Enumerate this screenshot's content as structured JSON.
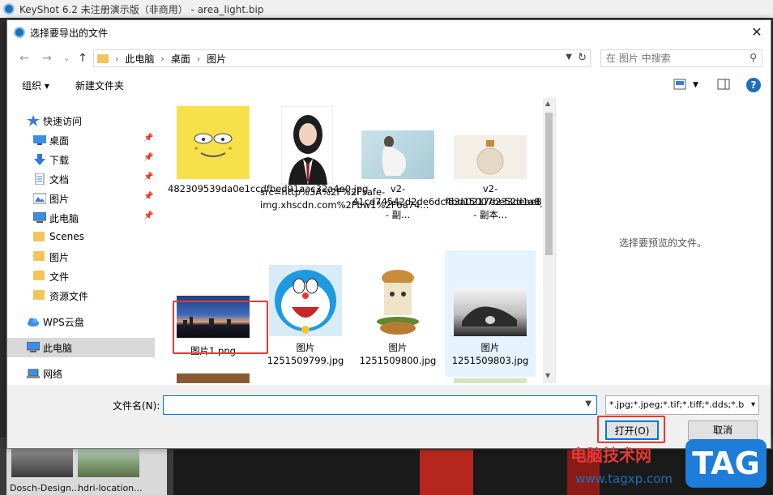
{
  "app": {
    "title": "KeyShot 6.2 未注册演示版（非商用） - area_light.bip",
    "thumbs": [
      {
        "label": "Dosch-Design..."
      },
      {
        "label": "hdri-location..."
      }
    ]
  },
  "dialog": {
    "title": "选择要导出的文件",
    "close_label": "✕",
    "nav": {
      "back": "←",
      "forward": "→",
      "recent": "⌄",
      "up": "↑",
      "breadcrumb": [
        "此电脑",
        "桌面",
        "图片"
      ],
      "search_placeholder": "在 图片 中搜索"
    },
    "toolbar": {
      "organize": "组织 ▾",
      "new_folder": "新建文件夹",
      "help": "?"
    },
    "sidebar": [
      {
        "label": "快速访问",
        "icon": "star-icon",
        "pinned": false
      },
      {
        "label": "桌面",
        "icon": "desktop-icon",
        "pinned": true
      },
      {
        "label": "下载",
        "icon": "download-icon",
        "pinned": true
      },
      {
        "label": "文档",
        "icon": "document-icon",
        "pinned": true
      },
      {
        "label": "图片",
        "icon": "pictures-icon",
        "pinned": true
      },
      {
        "label": "此电脑",
        "icon": "computer-icon",
        "pinned": true
      },
      {
        "label": "Scenes",
        "icon": "folder-icon",
        "pinned": false
      },
      {
        "label": "图片",
        "icon": "folder-icon",
        "pinned": false
      },
      {
        "label": "文件",
        "icon": "folder-icon",
        "pinned": false
      },
      {
        "label": "资源文件",
        "icon": "folder-icon",
        "pinned": false
      },
      {
        "label": "WPS云盘",
        "icon": "cloud-icon",
        "pinned": false
      },
      {
        "label": "此电脑",
        "icon": "computer-icon",
        "pinned": false
      },
      {
        "label": "网络",
        "icon": "network-icon",
        "pinned": false
      }
    ],
    "files": [
      {
        "name": "482309539da0e1ccdfbed91aac32a4e0.jpg"
      },
      {
        "name": "src=http%3A%2F%2Fsafe-img.xhscdn.com%2Fbw1%2F6a74..."
      },
      {
        "name": "v2-41cd74542d2de6dc4bd15007be52d1a8_720w.webp - 副..."
      },
      {
        "name": "v2-f53a0217e233deae899d80b9416a91ad_720w.webp - 副本..."
      },
      {
        "name": "图片1.png"
      },
      {
        "name": "图片 1251509799.jpg"
      },
      {
        "name": "图片 1251509800.jpg"
      },
      {
        "name": "图片 1251509803.jpg"
      }
    ],
    "preview_message": "选择要预览的文件。",
    "bottom": {
      "filename_label": "文件名(N):",
      "filename_value": "",
      "filter": "*.jpg;*.jpeg;*.tif;*.tiff;*.dds;*.b",
      "open_label": "打开(O)",
      "cancel_label": "取消"
    }
  },
  "watermark": {
    "title": "电脑技术网",
    "url": "www.tagxp.com",
    "tag": "TAG"
  },
  "colors": {
    "accent": "#0078d7",
    "highlight_box": "#e53935",
    "selection": "#cce8ff"
  }
}
